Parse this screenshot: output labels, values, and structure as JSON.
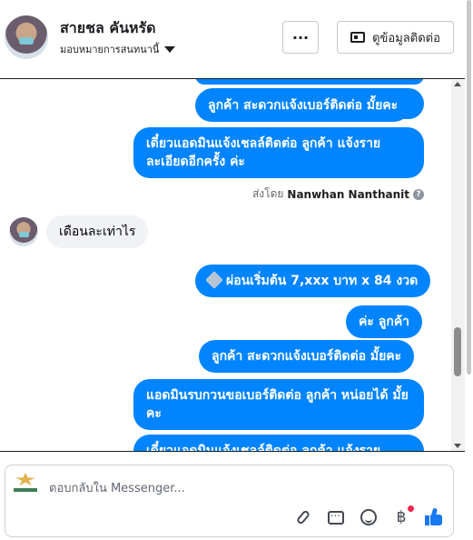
{
  "header": {
    "customer_name": "สายชล คันหรัด",
    "assign_label": "มอบหมายการสนทนานี้",
    "more_label": "···",
    "contact_info_label": "ดูข้อมูลติดต่อ"
  },
  "conversation": {
    "messages": [
      {
        "direction": "out",
        "text": "ลูกค้า  สะดวกแจ้งเบอร์ติดต่อ มั้ยคะ"
      },
      {
        "direction": "out",
        "text": "เดี๋ยวแอดมินแจ้งเชลล์ติดต่อ ลูกค้า   แจ้งราย ละเอียดอีกครั้ง ค่ะ"
      },
      {
        "direction": "in",
        "text": "เดือนละเท่าไร"
      },
      {
        "direction": "out",
        "text": "ผ่อนเริ่มต้น 7,xxx บาท x 84 งวด",
        "emoji": "airplane"
      },
      {
        "direction": "out",
        "text": "ค่ะ  ลูกค้า"
      },
      {
        "direction": "out",
        "text": "ลูกค้า สะดวกแจ้งเบอร์ติดต่อ มั้ยคะ"
      },
      {
        "direction": "out",
        "text": "แอดมินรบกวนขอเบอร์ติดต่อ ลูกค้า หน่อยได้ มั้ยคะ"
      },
      {
        "direction": "out",
        "text": "เดี๋ยวแอดมินแจ้งเชลล์ติดต่อ ลูกค้า   แจ้งราย"
      }
    ],
    "sent_by_prefix": "ส่งโดย",
    "sent_by_name": "Nanwhan Nanthanit"
  },
  "composer": {
    "placeholder": "ตอบกลับใน Messenger...",
    "icons": [
      "attachment-icon",
      "saved-reply-icon",
      "emoji-icon",
      "payment-icon",
      "like-icon"
    ],
    "payment_symbol": "฿"
  },
  "colors": {
    "outgoing_bubble": "#0084ff",
    "incoming_bubble": "#f0f2f5",
    "like_blue": "#1877f2",
    "notification_dot": "#f02849"
  }
}
